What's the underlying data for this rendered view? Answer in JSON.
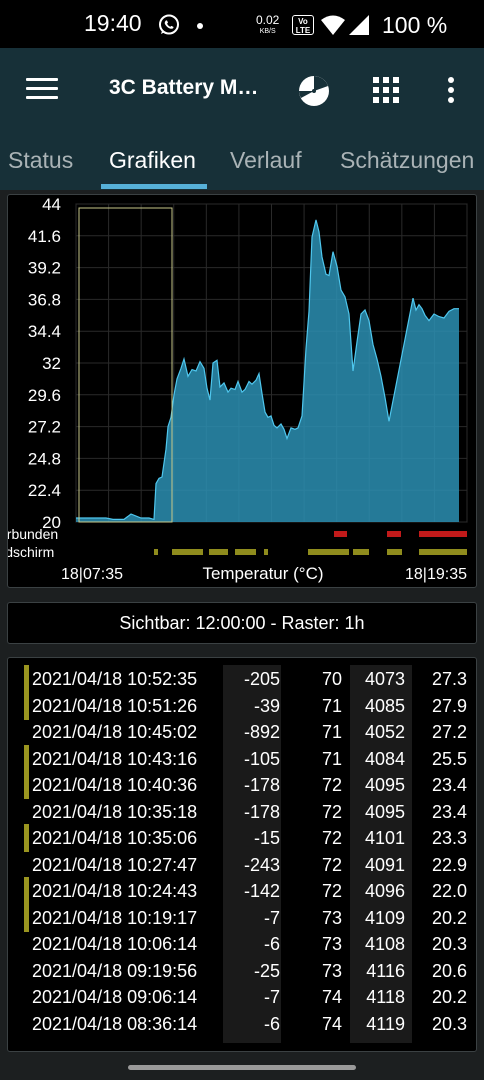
{
  "status_bar": {
    "time": "19:40",
    "net_speed": "0.02",
    "net_unit": "KB/S",
    "volte_top": "Vo",
    "volte_bottom": "LTE",
    "battery": "100 %"
  },
  "app_bar": {
    "title": "3C Battery M…",
    "icons": [
      "menu-icon",
      "pie-chart-icon",
      "grid-icon",
      "more-vert-icon"
    ]
  },
  "tabs": [
    {
      "label": "Status",
      "active": false
    },
    {
      "label": "Grafiken",
      "active": true
    },
    {
      "label": "Verlauf",
      "active": false
    },
    {
      "label": "Schätzungen",
      "active": false
    }
  ],
  "chart": {
    "x_start_label": "18|07:35",
    "x_end_label": "18|19:35",
    "title": "Temperatur (°C)",
    "track_labels": [
      "erbunden",
      "ildschirm"
    ],
    "colors": {
      "fill": "#2b8fb3",
      "line": "#4fc7ee",
      "grid": "#2a2a2a",
      "track_yellow": "#8f8c1d",
      "track_red": "#c21a1a",
      "window": "#c9c98a"
    }
  },
  "chart_data": {
    "type": "area",
    "title": "Temperatur (°C)",
    "y_ticks": [
      "44",
      "41.6",
      "39.2",
      "36.8",
      "34.4",
      "32",
      "29.6",
      "27.2",
      "24.8",
      "22.4",
      "20"
    ],
    "ylim": [
      20,
      44
    ],
    "x_labels": [
      "18|07:35",
      "18|19:35"
    ],
    "grid": true,
    "series": [
      {
        "values": [
          20.3,
          20.3,
          20.3,
          20.3,
          20.2,
          20.2,
          20.2,
          20.6,
          20.3,
          20.3,
          20.2,
          22.9,
          23.3,
          23.4,
          25.5,
          27.2,
          27.9,
          29.6,
          30.8,
          31.6,
          32.3,
          31.0,
          31.5,
          31.4,
          32.1,
          31.6,
          30.1,
          29.2,
          32.0,
          32.2,
          30.2,
          30.5,
          29.8,
          30.1,
          30.0,
          30.6,
          29.8,
          30.0,
          30.6,
          30.4,
          30.7,
          31.2,
          29.7,
          28.3,
          27.9,
          28.0,
          27.3,
          27.1,
          27.4,
          27.0,
          26.3,
          27.1,
          27.0,
          27.1,
          28.0,
          33.1,
          35.9,
          41.5,
          42.8,
          41.9,
          40.0,
          38.7,
          38.6,
          40.4,
          39.3,
          37.5,
          37.0,
          35.7,
          31.4,
          33.6,
          35.7,
          36.0,
          35.2,
          33.4,
          32.3,
          31.0,
          29.4,
          27.6,
          36.9,
          36.0,
          36.4,
          36.1,
          35.6,
          35.2,
          35.7,
          35.5,
          35.4,
          35.9,
          36.1,
          36.1
        ],
        "x_positions": [
          75,
          85,
          95,
          105,
          112,
          117,
          123,
          130,
          140,
          148,
          153,
          155,
          158,
          161,
          165,
          167,
          170,
          173,
          176,
          180,
          183,
          187,
          191,
          195,
          199,
          203,
          206,
          209,
          212,
          216,
          219,
          223,
          227,
          230,
          234,
          237,
          241,
          244,
          248,
          251,
          255,
          258,
          261,
          264,
          267,
          270,
          273,
          276,
          280,
          283,
          286,
          290,
          294,
          297,
          301,
          305,
          308,
          311,
          315,
          318,
          321,
          325,
          328,
          332,
          336,
          340,
          344,
          348,
          352,
          356,
          360,
          364,
          368,
          372,
          376,
          380,
          384,
          388,
          412,
          415,
          418,
          421,
          424,
          428,
          433,
          438,
          443,
          448,
          453,
          458
        ]
      }
    ],
    "tracks": {
      "erbunden": {
        "color": "#c21a1a",
        "segments": [
          [
            333,
            346
          ],
          [
            386,
            400
          ],
          [
            418,
            466
          ]
        ]
      },
      "ildschirm": {
        "color": "#8f8c1d",
        "segments": [
          [
            153,
            157
          ],
          [
            171,
            202
          ],
          [
            208,
            227
          ],
          [
            234,
            255
          ],
          [
            263,
            267
          ],
          [
            307,
            348
          ],
          [
            352,
            368
          ],
          [
            386,
            401
          ],
          [
            418,
            466
          ]
        ]
      }
    }
  },
  "info_bar": {
    "text": "Sichtbar: 12:00:00 - Raster: 1h"
  },
  "history": {
    "rows": [
      {
        "date": "2021/04/18 10:52:35",
        "current": "-205",
        "level": "70",
        "mv": "4073",
        "temp": "27.3",
        "marker": true
      },
      {
        "date": "2021/04/18 10:51:26",
        "current": "-39",
        "level": "71",
        "mv": "4085",
        "temp": "27.9",
        "marker": true
      },
      {
        "date": "2021/04/18 10:45:02",
        "current": "-892",
        "level": "71",
        "mv": "4052",
        "temp": "27.2",
        "marker": false
      },
      {
        "date": "2021/04/18 10:43:16",
        "current": "-105",
        "level": "71",
        "mv": "4084",
        "temp": "25.5",
        "marker": true
      },
      {
        "date": "2021/04/18 10:40:36",
        "current": "-178",
        "level": "72",
        "mv": "4095",
        "temp": "23.4",
        "marker": true
      },
      {
        "date": "2021/04/18 10:35:18",
        "current": "-178",
        "level": "72",
        "mv": "4095",
        "temp": "23.4",
        "marker": false
      },
      {
        "date": "2021/04/18 10:35:06",
        "current": "-15",
        "level": "72",
        "mv": "4101",
        "temp": "23.3",
        "marker": true
      },
      {
        "date": "2021/04/18 10:27:47",
        "current": "-243",
        "level": "72",
        "mv": "4091",
        "temp": "22.9",
        "marker": false
      },
      {
        "date": "2021/04/18 10:24:43",
        "current": "-142",
        "level": "72",
        "mv": "4096",
        "temp": "22.0",
        "marker": true
      },
      {
        "date": "2021/04/18 10:19:17",
        "current": "-7",
        "level": "73",
        "mv": "4109",
        "temp": "20.2",
        "marker": true
      },
      {
        "date": "2021/04/18 10:06:14",
        "current": "-6",
        "level": "73",
        "mv": "4108",
        "temp": "20.3",
        "marker": false
      },
      {
        "date": "2021/04/18 09:19:56",
        "current": "-25",
        "level": "73",
        "mv": "4116",
        "temp": "20.6",
        "marker": false
      },
      {
        "date": "2021/04/18 09:06:14",
        "current": "-7",
        "level": "74",
        "mv": "4118",
        "temp": "20.2",
        "marker": false
      },
      {
        "date": "2021/04/18 08:36:14",
        "current": "-6",
        "level": "74",
        "mv": "4119",
        "temp": "20.3",
        "marker": false
      }
    ]
  }
}
